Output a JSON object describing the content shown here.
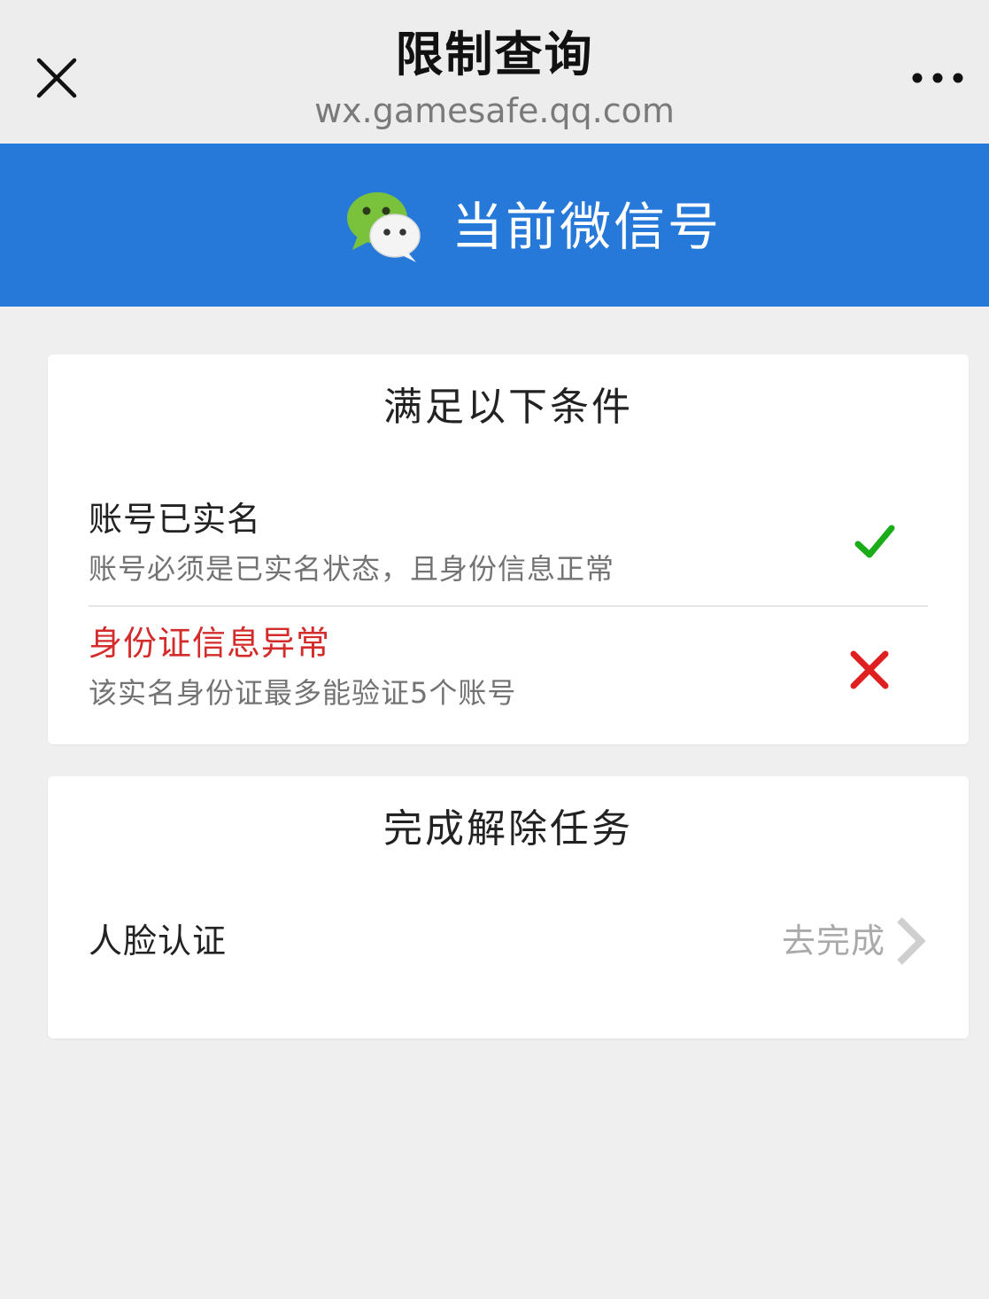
{
  "nav": {
    "title": "限制查询",
    "url": "wx.gamesafe.qq.com",
    "close_icon": "close-icon",
    "more_icon": "more-icon"
  },
  "header": {
    "title": "当前微信号",
    "logo_icon": "wechat-logo-icon",
    "background_color": "#2779d9"
  },
  "conditions": {
    "title": "满足以下条件",
    "items": [
      {
        "title": "账号已实名",
        "description": "账号必须是已实名状态，且身份信息正常",
        "status": "pass",
        "status_icon": "check-icon",
        "status_color": "#1aad19"
      },
      {
        "title": "身份证信息异常",
        "description": "该实名身份证最多能验证5个账号",
        "status": "fail",
        "status_icon": "cross-icon",
        "status_color": "#e02020"
      }
    ]
  },
  "tasks": {
    "title": "完成解除任务",
    "items": [
      {
        "label": "人脸认证",
        "action_label": "去完成",
        "action_icon": "chevron-right-icon"
      }
    ]
  }
}
